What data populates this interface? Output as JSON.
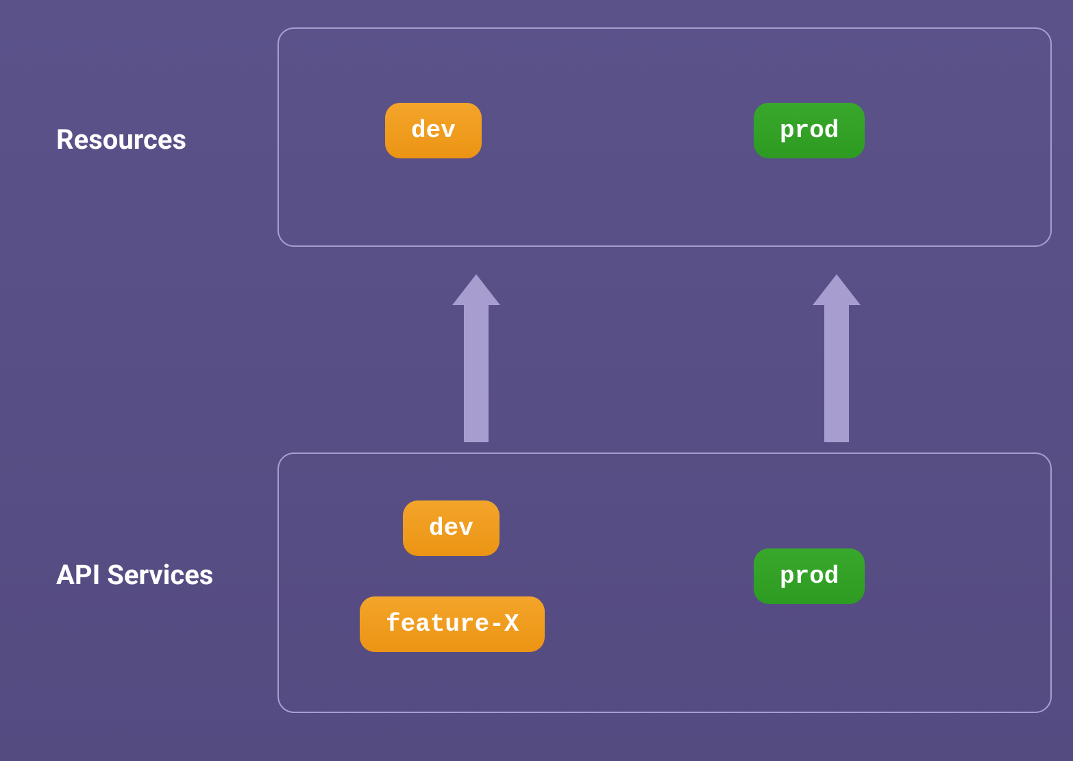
{
  "labels": {
    "resources": "Resources",
    "api_services": "API Services"
  },
  "resources_box": {
    "dev": "dev",
    "prod": "prod"
  },
  "api_services_box": {
    "dev": "dev",
    "feature_x": "feature-X",
    "prod": "prod"
  },
  "colors": {
    "background": "#5a5189",
    "border": "#a89dcf",
    "arrow": "#a89dcf",
    "orange": "#eea020",
    "green": "#32a326",
    "text": "#ffffff"
  }
}
